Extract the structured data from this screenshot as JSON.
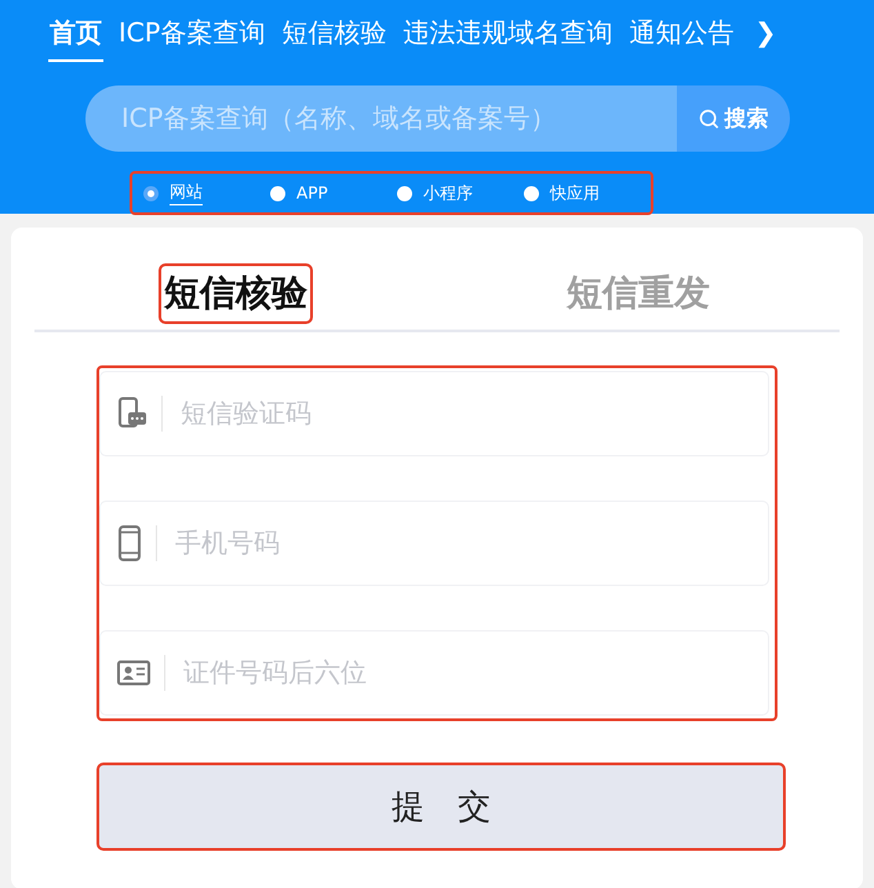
{
  "nav": {
    "items": [
      {
        "label": "首页",
        "selected": true
      },
      {
        "label": "ICP备案查询",
        "selected": false
      },
      {
        "label": "短信核验",
        "selected": false
      },
      {
        "label": "违法违规域名查询",
        "selected": false
      },
      {
        "label": "通知公告",
        "selected": false
      }
    ],
    "more": "❯"
  },
  "search": {
    "placeholder": "ICP备案查询（名称、域名或备案号）",
    "button": "搜索"
  },
  "types": {
    "highlighted": true,
    "options": [
      {
        "label": "网站",
        "selected": true
      },
      {
        "label": "APP",
        "selected": false
      },
      {
        "label": "小程序",
        "selected": false
      },
      {
        "label": "快应用",
        "selected": false
      }
    ]
  },
  "tabs": [
    {
      "label": "短信核验",
      "selected": true,
      "highlighted": true
    },
    {
      "label": "短信重发",
      "selected": false,
      "highlighted": false
    }
  ],
  "form": {
    "highlighted": true,
    "fields": [
      {
        "kind": "sms",
        "placeholder": "短信验证码"
      },
      {
        "kind": "phone",
        "placeholder": "手机号码"
      },
      {
        "kind": "id",
        "placeholder": "证件号码后六位"
      }
    ]
  },
  "submit": {
    "label": "提　交",
    "highlighted": true
  }
}
